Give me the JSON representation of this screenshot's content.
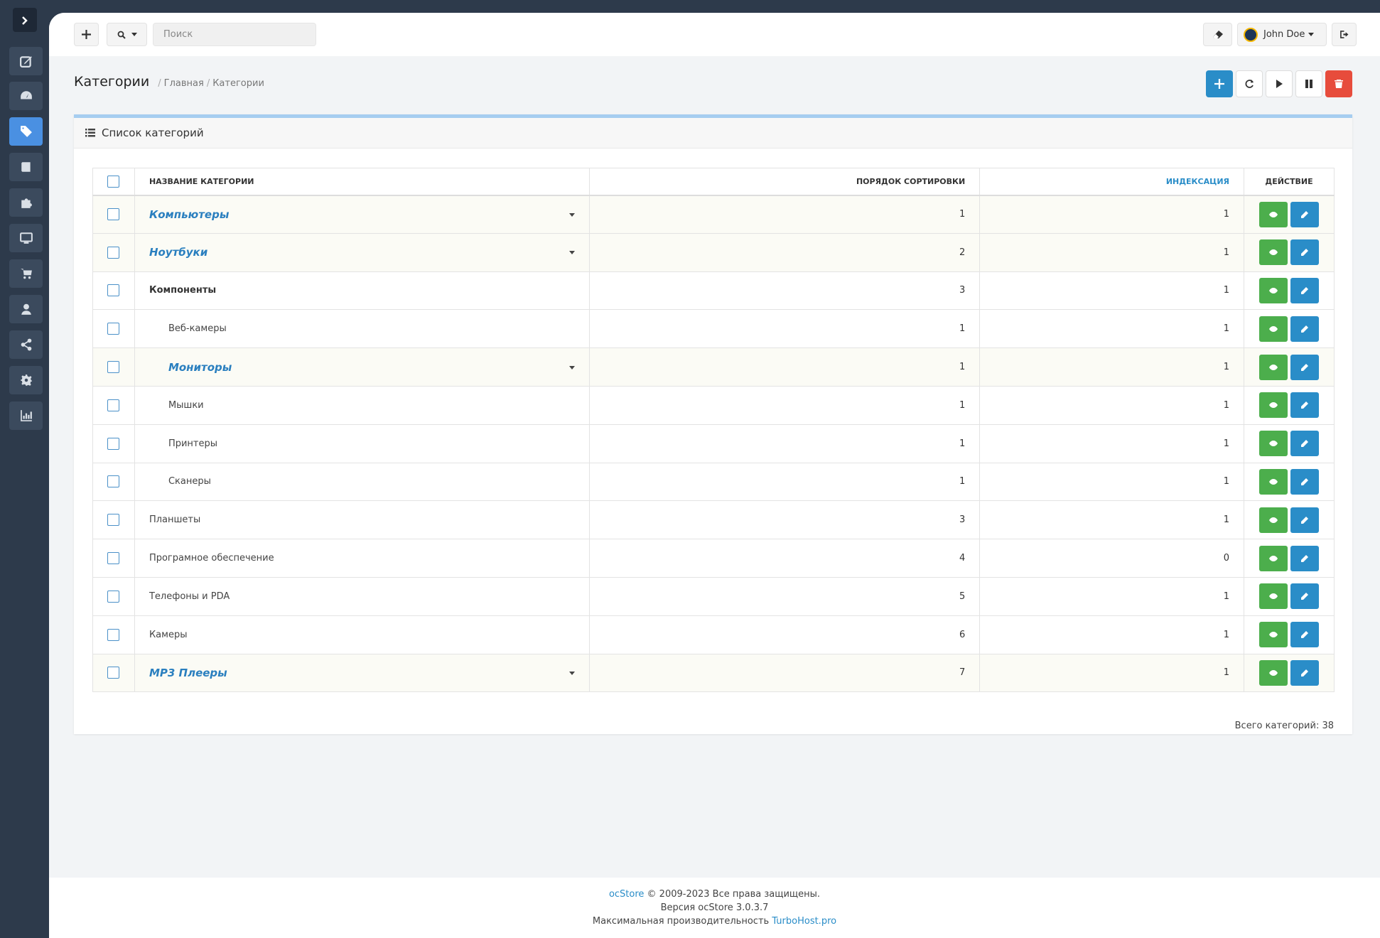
{
  "sidebar": {
    "items": [
      {
        "name": "edit-icon"
      },
      {
        "name": "dashboard-icon"
      },
      {
        "name": "tags-icon",
        "active": true
      },
      {
        "name": "book-icon"
      },
      {
        "name": "puzzle-icon"
      },
      {
        "name": "monitor-icon"
      },
      {
        "name": "cart-icon"
      },
      {
        "name": "user-icon"
      },
      {
        "name": "share-icon"
      },
      {
        "name": "gear-icon"
      },
      {
        "name": "chart-icon"
      }
    ]
  },
  "topbar": {
    "search_placeholder": "Поиск",
    "user_name": "John Doe"
  },
  "page": {
    "title": "Категории",
    "breadcrumb": [
      "Главная",
      "Категории"
    ]
  },
  "panel": {
    "title": "Список категорий"
  },
  "table": {
    "headers": {
      "name": "НАЗВАНИЕ КАТЕГОРИИ",
      "sort": "ПОРЯДОК СОРТИРОВКИ",
      "index": "ИНДЕКСАЦИЯ",
      "action": "ДЕЙСТВИЕ"
    },
    "rows": [
      {
        "name": "Компьютеры",
        "sort": "1",
        "index": "1",
        "type": "parent",
        "level": 0
      },
      {
        "name": "Ноутбуки",
        "sort": "2",
        "index": "1",
        "type": "parent",
        "level": 0
      },
      {
        "name": "Компоненты",
        "sort": "3",
        "index": "1",
        "type": "bold",
        "level": 0
      },
      {
        "name": "Веб-камеры",
        "sort": "1",
        "index": "1",
        "type": "plain",
        "level": 1
      },
      {
        "name": "Мониторы",
        "sort": "1",
        "index": "1",
        "type": "parent",
        "level": 1
      },
      {
        "name": "Мышки",
        "sort": "1",
        "index": "1",
        "type": "plain",
        "level": 1
      },
      {
        "name": "Принтеры",
        "sort": "1",
        "index": "1",
        "type": "plain",
        "level": 1
      },
      {
        "name": "Сканеры",
        "sort": "1",
        "index": "1",
        "type": "plain",
        "level": 1
      },
      {
        "name": "Планшеты",
        "sort": "3",
        "index": "1",
        "type": "plain",
        "level": 0
      },
      {
        "name": "Програмное обеспечение",
        "sort": "4",
        "index": "0",
        "type": "plain",
        "level": 0
      },
      {
        "name": "Телефоны и PDA",
        "sort": "5",
        "index": "1",
        "type": "plain",
        "level": 0
      },
      {
        "name": "Камеры",
        "sort": "6",
        "index": "1",
        "type": "plain",
        "level": 0
      },
      {
        "name": "MP3 Плееры",
        "sort": "7",
        "index": "1",
        "type": "parent",
        "level": 0
      }
    ],
    "total": "Всего категорий: 38"
  },
  "footer": {
    "brand": "ocStore",
    "copyright": "© 2009-2023 Все права защищены.",
    "version": "Версия ocStore 3.0.3.7",
    "perf_prefix": "Максимальная производительность",
    "host_link": "TurboHost.pro"
  },
  "colors": {
    "accent": "#2a8dc8",
    "success": "#4cae4c",
    "danger": "#e74c3c",
    "sidebar": "#2d3a4b"
  }
}
